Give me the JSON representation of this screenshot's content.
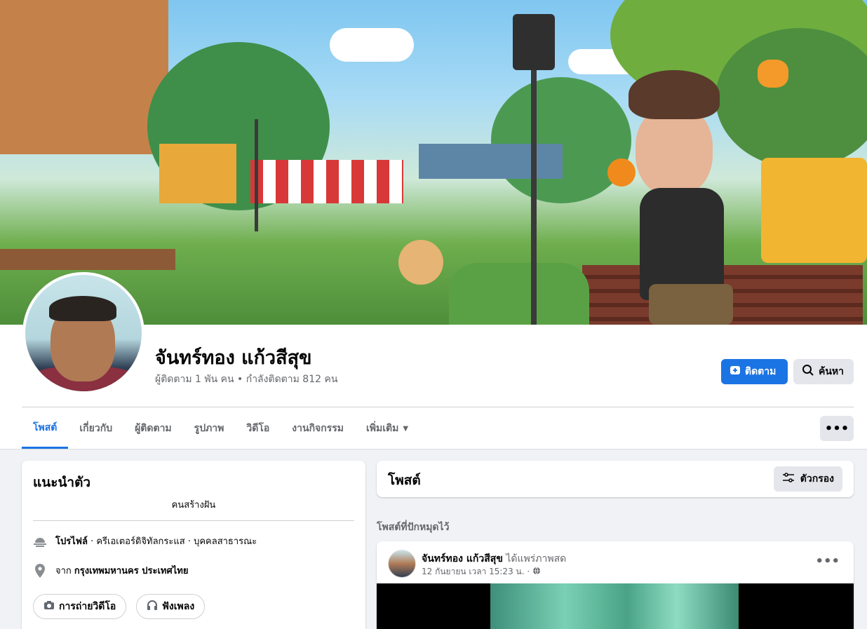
{
  "profile": {
    "name": "จันทร์ทอง แก้วสีสุข",
    "stats": "ผู้ติดตาม 1 พัน คน • กำลังติดตาม 812 คน"
  },
  "actions": {
    "follow_label": "ติดตาม",
    "search_label": "ค้นหา",
    "more_label": "•••"
  },
  "tabs": [
    {
      "label": "โพสต์",
      "active": true
    },
    {
      "label": "เกี่ยวกับ"
    },
    {
      "label": "ผู้ติดตาม"
    },
    {
      "label": "รูปภาพ"
    },
    {
      "label": "วิดีโอ"
    },
    {
      "label": "งานกิจกรรม"
    },
    {
      "label": "เพิ่มเติม"
    }
  ],
  "intro": {
    "title": "แนะนำตัว",
    "bio": "คนสร้างฝัน",
    "profile_type_label": "โปรไฟล์",
    "profile_type_detail": " · ครีเอเตอร์ดิจิทัลกระแส · บุคคลสาธารณะ",
    "from_prefix": "จาก ",
    "location": "กรุงเทพมหานคร ประเทศไทย",
    "chips": [
      "การถ่ายวิดีโอ",
      "ฟังเพลง"
    ]
  },
  "posts": {
    "title": "โพสต์",
    "filter_label": "ตัวกรอง",
    "pinned_label": "โพสต์ที่ปักหมุดไว้",
    "pinned_post": {
      "author": "จันทร์ทอง แก้วสีสุข",
      "action": " ได้แพร่ภาพสด",
      "timestamp": "12 กันยายน เวลา 15:23 น. ·"
    }
  },
  "colors": {
    "accent": "#1b74e4",
    "page_bg": "#f0f2f5"
  }
}
